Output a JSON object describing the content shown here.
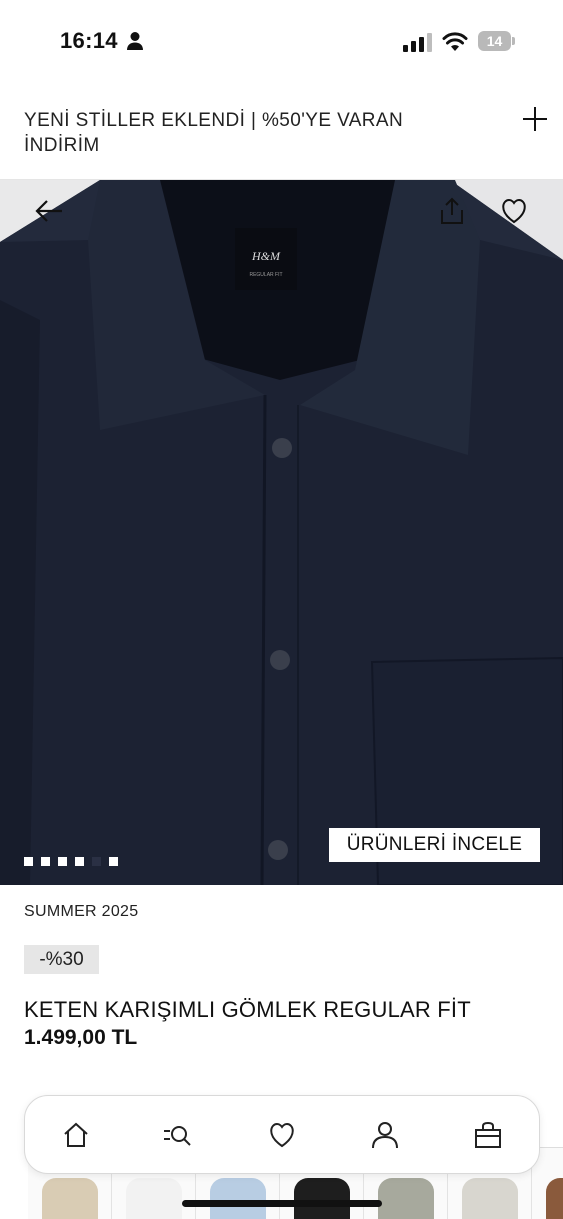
{
  "status_bar": {
    "time": "16:14",
    "battery": "14"
  },
  "promo": {
    "text": "YENİ STİLLER EKLENDİ | %50'YE VARAN İNDİRİM",
    "expand_icon": "plus-icon"
  },
  "hero": {
    "explore_button": "ÜRÜNLERİ İNCELE",
    "label_brand": "H&M",
    "label_fit": "REGULAR FIT",
    "image_count": 6,
    "active_image": 5,
    "colors": {
      "fabric": "#1c2233",
      "shadow": "#101522"
    }
  },
  "product": {
    "collection": "SUMMER 2025",
    "discount": "-%30",
    "name": "KETEN KARIŞIMLI GÖMLEK REGULAR FİT",
    "price": "1.499,00 TL"
  },
  "thumbnails": [
    {
      "name": "beige-shirt",
      "color": "#d9ccb4"
    },
    {
      "name": "white-shirt",
      "color": "#f2f2f2"
    },
    {
      "name": "light-blue-shirt",
      "color": "#b8cde3"
    },
    {
      "name": "black-shirt",
      "color": "#1e1e1e"
    },
    {
      "name": "grey-shirt",
      "color": "#a7a99d"
    },
    {
      "name": "striped-shirt",
      "color": "#d8d6cf"
    },
    {
      "name": "brown-shirt",
      "color": "#8a5a3c"
    }
  ],
  "nav": {
    "items": [
      "home-icon",
      "search-icon",
      "heart-icon",
      "account-icon",
      "bag-icon"
    ]
  }
}
